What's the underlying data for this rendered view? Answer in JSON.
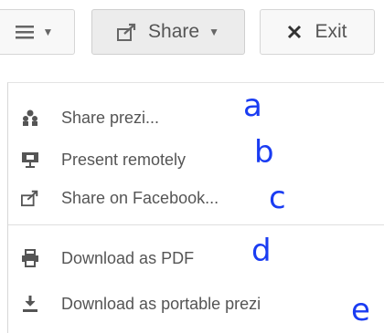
{
  "toolbar": {
    "share_label": "Share",
    "exit_label": "Exit"
  },
  "menu": {
    "items": [
      {
        "label": "Share prezi...",
        "icon": "share-people-icon"
      },
      {
        "label": "Present remotely",
        "icon": "present-remotely-icon"
      },
      {
        "label": "Share on Facebook...",
        "icon": "share-external-icon"
      },
      {
        "label": "Download as PDF",
        "icon": "printer-icon"
      },
      {
        "label": "Download as portable prezi",
        "icon": "download-icon"
      }
    ]
  },
  "annotations": [
    "a",
    "b",
    "c",
    "d",
    "e"
  ],
  "colors": {
    "annotation": "#1a3cf2"
  }
}
